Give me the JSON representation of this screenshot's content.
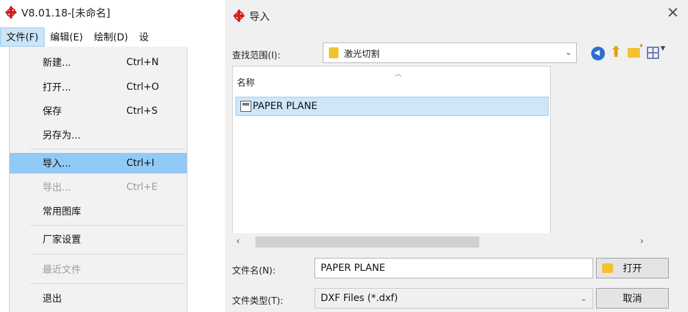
{
  "app": {
    "title": "V8.01.18-[未命名]",
    "menubar": [
      "文件(F)",
      "编辑(E)",
      "绘制(D)",
      "设"
    ],
    "menu": {
      "new": {
        "label": "新建...",
        "shortcut": "Ctrl+N"
      },
      "open": {
        "label": "打开...",
        "shortcut": "Ctrl+O"
      },
      "save": {
        "label": "保存",
        "shortcut": "Ctrl+S"
      },
      "save_as": {
        "label": "另存为..."
      },
      "import": {
        "label": "导入...",
        "shortcut": "Ctrl+I"
      },
      "export": {
        "label": "导出...",
        "shortcut": "Ctrl+E"
      },
      "library": {
        "label": "常用图库"
      },
      "factory": {
        "label": "厂家设置"
      },
      "recent": {
        "label": "最近文件"
      },
      "exit": {
        "label": "退出"
      }
    }
  },
  "dialog": {
    "title": "导入",
    "lookin_label": "查找范围(I):",
    "lookin_value": "激光切割",
    "column_name": "名称",
    "files": [
      "PAPER PLANE"
    ],
    "filename_label": "文件名(N):",
    "filename_value": "PAPER PLANE",
    "filetype_label": "文件类型(T):",
    "filetype_value": "DXF Files (*.dxf)",
    "open_button": "打开",
    "cancel_button": "取消"
  },
  "colors": {
    "highlight": "#91c9f7",
    "selection": "#cfe6f8",
    "logo": "#d02020"
  }
}
